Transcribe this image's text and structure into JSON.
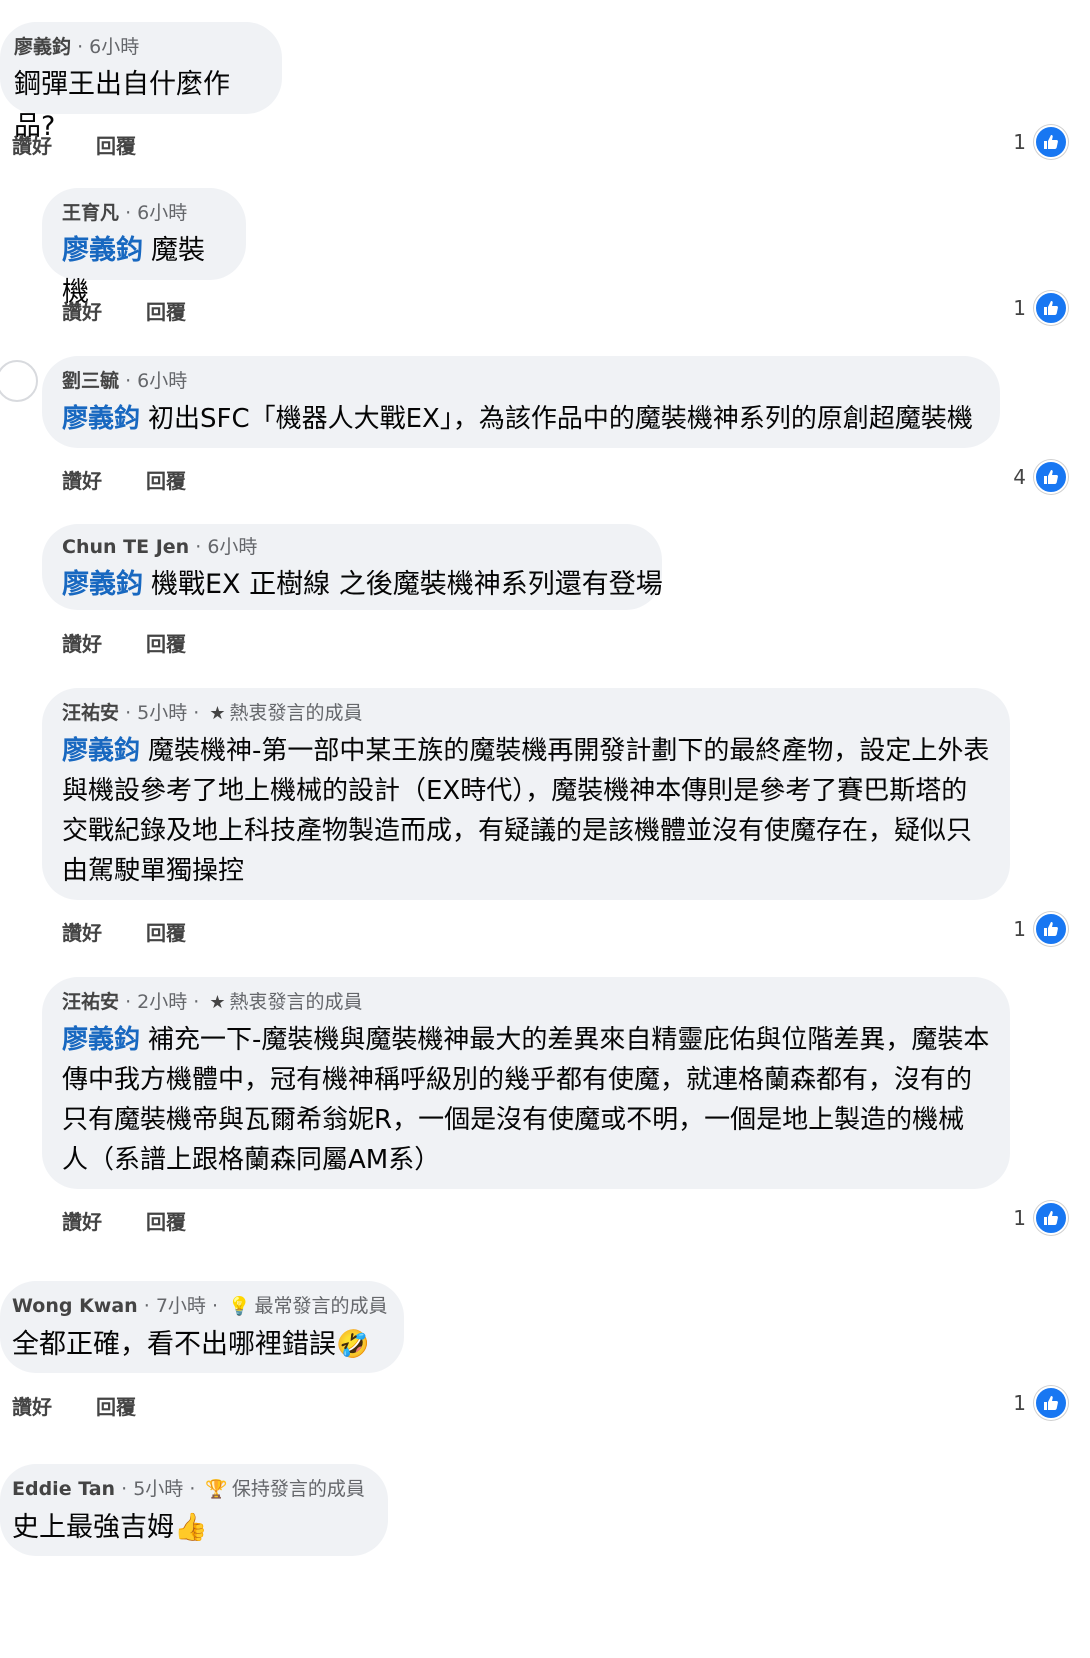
{
  "action_labels": {
    "like": "讚好",
    "reply": "回覆"
  },
  "comments": [
    {
      "author": "廖義鈞",
      "time": "· 6小時",
      "badge": "",
      "mention": "",
      "text": "鋼彈王出自什麼作品?",
      "likes": "1"
    },
    {
      "author": "王育凡",
      "time": "· 6小時",
      "badge": "",
      "mention": "廖義鈞",
      "text": "魔裝機",
      "likes": "1"
    },
    {
      "author": "劉三毓",
      "time": "· 6小時",
      "badge": "",
      "mention": "廖義鈞",
      "text": "初出SFC「機器人大戰EX」，為該作品中的魔裝機神系列的原創超魔裝機",
      "likes": "4"
    },
    {
      "author": "Chun TE Jen",
      "time": "· 6小時",
      "badge": "",
      "mention": "廖義鈞",
      "text": "機戰EX 正樹線 之後魔裝機神系列還有登場",
      "likes": ""
    },
    {
      "author": "汪祐安",
      "time": "· 5小時 ·",
      "badge": "熱衷發言的成員",
      "badge_icon": "star-icon",
      "mention": "廖義鈞",
      "text": "魔裝機神-第一部中某王族的魔裝機再開發計劃下的最終產物，設定上外表與機設參考了地上機械的設計（EX時代），魔裝機神本傳則是參考了賽巴斯塔的交戰紀錄及地上科技產物製造而成，有疑議的是該機體並沒有使魔存在，疑似只由駕駛單獨操控",
      "likes": "1"
    },
    {
      "author": "汪祐安",
      "time": "· 2小時 ·",
      "badge": "熱衷發言的成員",
      "badge_icon": "star-icon",
      "mention": "廖義鈞",
      "text": "補充一下-魔裝機與魔裝機神最大的差異來自精靈庇佑與位階差異，魔裝本傳中我方機體中，冠有機神稱呼級別的幾乎都有使魔，就連格蘭森都有，沒有的只有魔裝機帝與瓦爾希翁妮R，一個是沒有使魔或不明，一個是地上製造的機械人（系譜上跟格蘭森同屬AM系）",
      "likes": "1"
    },
    {
      "author": "Wong Kwan",
      "time": "· 7小時 ·",
      "badge": "最常發言的成員",
      "badge_icon": "lightbulb-icon",
      "mention": "",
      "text": "全都正確，看不出哪裡錯誤🤣",
      "likes": "1"
    },
    {
      "author": "Eddie Tan",
      "time": "· 5小時 ·",
      "badge": "保持發言的成員",
      "badge_icon": "trophy-icon",
      "mention": "",
      "text": "史上最強吉姆👍",
      "likes": ""
    }
  ],
  "colors": {
    "bubble": "#f0f2f5",
    "mention": "#1868c0",
    "like_blue": "#1877f2",
    "meta": "#65676b"
  }
}
